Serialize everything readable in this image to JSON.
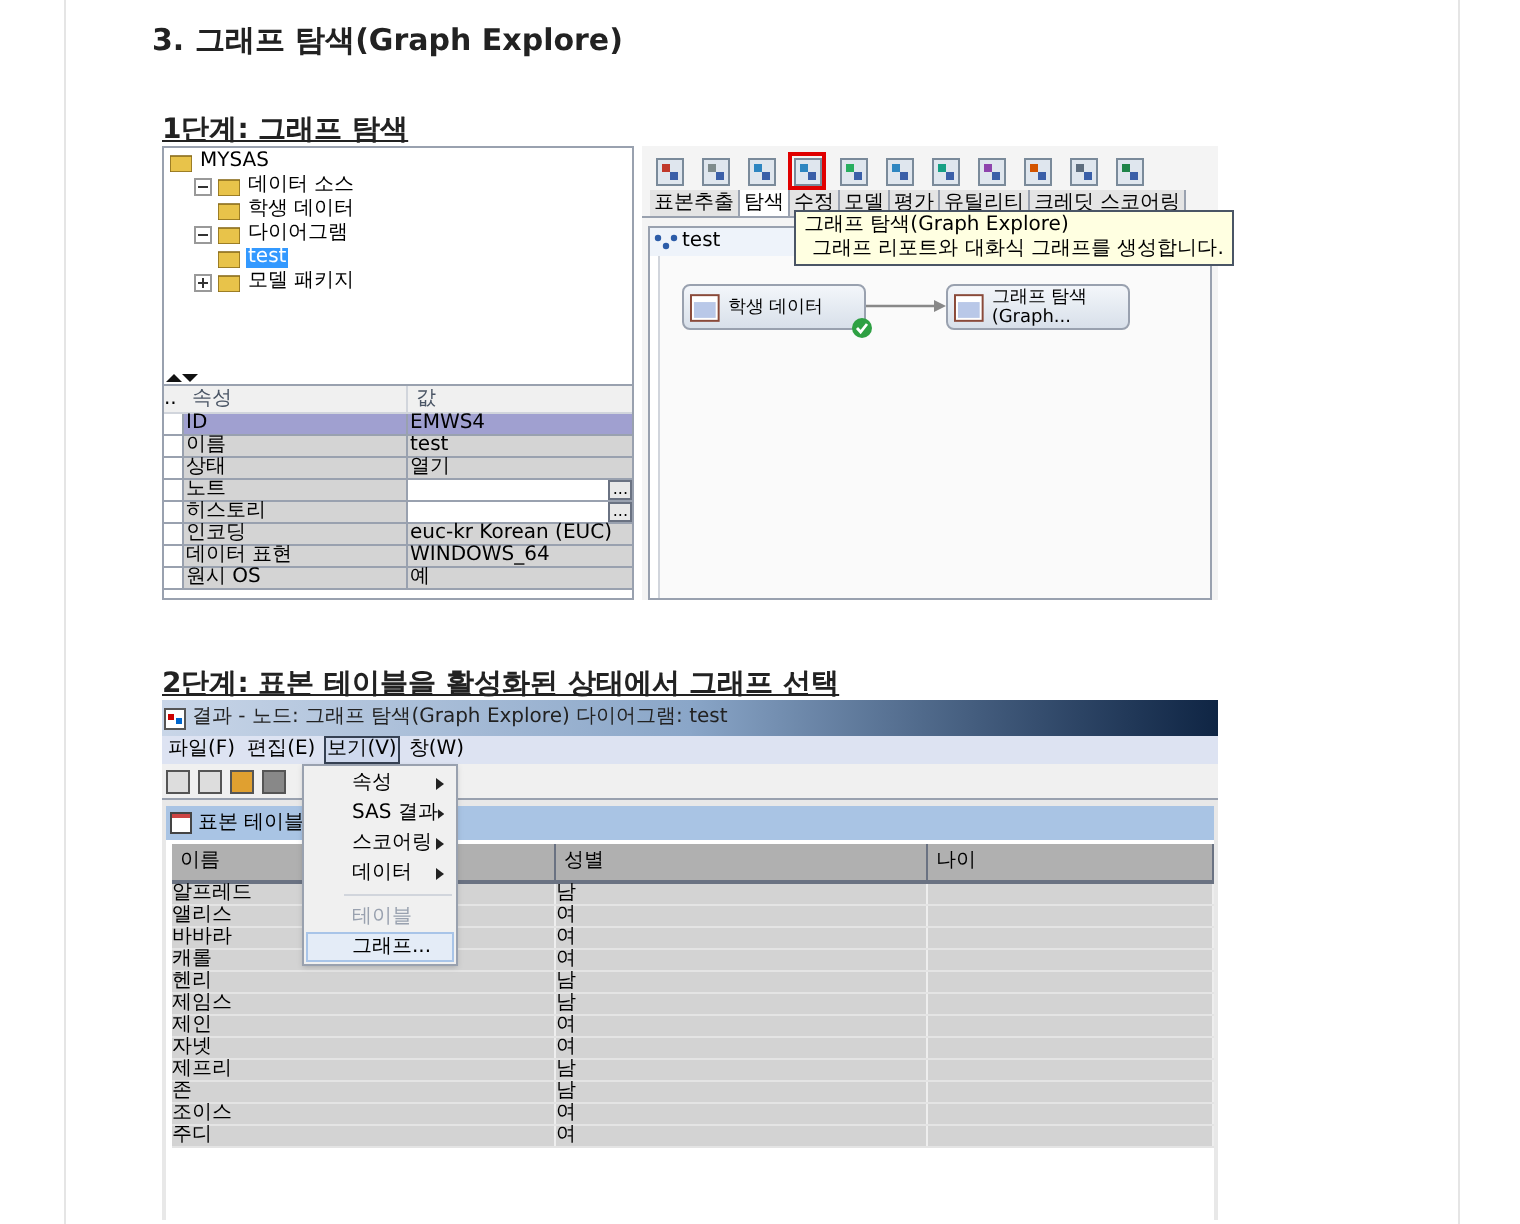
{
  "heading": "3. 그래프 탐색(Graph Explore)",
  "step1": {
    "title": "1단계: 그래프 탐색",
    "tree": [
      {
        "label": "MYSAS",
        "selected": false,
        "children": [
          {
            "label": "데이터 소스",
            "selected": false,
            "expanded": true,
            "children": [
              {
                "label": "학생 데이터",
                "selected": false
              }
            ]
          },
          {
            "label": "다이어그램",
            "selected": false,
            "expanded": true,
            "children": [
              {
                "label": "test",
                "selected": true
              }
            ]
          },
          {
            "label": "모델 패키지",
            "selected": false,
            "expanded": false
          }
        ]
      }
    ],
    "properties": {
      "columns": [
        "..",
        "속성",
        "값"
      ],
      "rows": [
        {
          "name": "ID",
          "value": "EMWS4",
          "selected": true
        },
        {
          "name": "이름",
          "value": "test",
          "selected": false
        },
        {
          "name": "상태",
          "value": "열기",
          "selected": false
        },
        {
          "name": "노트",
          "button": "...",
          "selected": false
        },
        {
          "name": "히스토리",
          "button": "...",
          "selected": false
        },
        {
          "name": "인코딩",
          "value": "euc-kr  Korean (EUC)",
          "selected": false
        },
        {
          "name": "데이터 표현",
          "value": "WINDOWS_64",
          "selected": false
        },
        {
          "name": "원시 OS",
          "value": "예",
          "selected": false
        }
      ]
    },
    "toolbar": [
      {
        "highlighted": false
      },
      {
        "highlighted": false
      },
      {
        "highlighted": false
      },
      {
        "highlighted": true
      },
      {
        "highlighted": false
      },
      {
        "highlighted": false
      },
      {
        "highlighted": false
      },
      {
        "highlighted": false
      },
      {
        "highlighted": false
      },
      {
        "highlighted": false
      },
      {
        "highlighted": false
      }
    ],
    "tabs": [
      {
        "label": "표본추출",
        "selected": false
      },
      {
        "label": "탐색",
        "selected": true
      },
      {
        "label": "수정",
        "selected": false
      },
      {
        "label": "모델",
        "selected": false
      },
      {
        "label": "평가",
        "selected": false
      },
      {
        "label": "유틸리티",
        "selected": false
      },
      {
        "label": "크레딧 스코어링",
        "selected": false
      }
    ],
    "tooltip": {
      "title": "그래프 탐색(Graph Explore)",
      "text": "그래프 리포트와 대화식 그래프를 생성합니다."
    },
    "diagram": {
      "title": "test",
      "nodes": [
        {
          "label": "학생 데이터",
          "completed": true
        },
        {
          "label": "그래프 탐색(Graph...",
          "completed": false
        }
      ]
    }
  },
  "step2": {
    "title": "2단계: 표본 테이블을 활성화된 상태에서 그래프 선택",
    "window_title": "결과 - 노드: 그래프 탐색(Graph Explore)  다이어그램: test",
    "menu": [
      {
        "label": "파일(F)",
        "open": false
      },
      {
        "label": "편집(E)",
        "open": false
      },
      {
        "label": "보기(V)",
        "open": true
      },
      {
        "label": "창(W)",
        "open": false
      }
    ],
    "dropdown": [
      {
        "kind": "item",
        "label": "속성",
        "submenu": true,
        "disabled": false,
        "highlighted": false
      },
      {
        "kind": "item",
        "label": "SAS 결과",
        "submenu": true,
        "disabled": false,
        "highlighted": false
      },
      {
        "kind": "item",
        "label": "스코어링",
        "submenu": true,
        "disabled": false,
        "highlighted": false
      },
      {
        "kind": "item",
        "label": "데이터",
        "submenu": true,
        "disabled": false,
        "highlighted": false
      },
      {
        "kind": "separator"
      },
      {
        "kind": "item",
        "label": "테이블",
        "submenu": false,
        "disabled": true,
        "highlighted": false
      },
      {
        "kind": "item",
        "label": "그래프...",
        "submenu": false,
        "disabled": false,
        "highlighted": true
      }
    ],
    "panel_title": "표본 테이블",
    "table": {
      "columns": [
        "이름",
        "성별",
        "나이"
      ],
      "rows": [
        [
          "알프레드",
          "남"
        ],
        [
          "앨리스",
          "여"
        ],
        [
          "바바라",
          "여"
        ],
        [
          "캐롤",
          "여"
        ],
        [
          "헨리",
          "남"
        ],
        [
          "제임스",
          "남"
        ],
        [
          "제인",
          "여"
        ],
        [
          "자넷",
          "여"
        ],
        [
          "제프리",
          "남"
        ],
        [
          "존",
          "남"
        ],
        [
          "조이스",
          "여"
        ],
        [
          "주디",
          "여"
        ]
      ]
    }
  }
}
